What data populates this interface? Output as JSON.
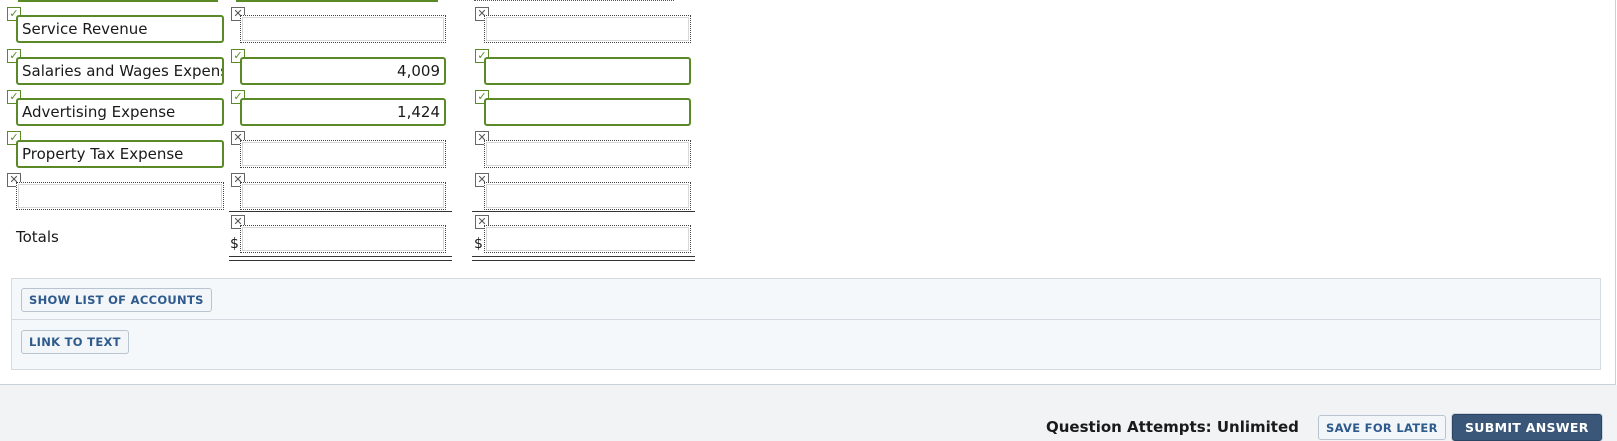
{
  "rows": [
    {
      "account": "Service Revenue",
      "debit": "",
      "credit": ""
    },
    {
      "account": "Salaries and Wages Expens",
      "debit": "4,009",
      "credit": ""
    },
    {
      "account": "Advertising Expense",
      "debit": "1,424",
      "credit": ""
    },
    {
      "account": "Property Tax Expense",
      "debit": "",
      "credit": ""
    },
    {
      "account": "",
      "debit": "",
      "credit": ""
    }
  ],
  "marks": {
    "check": "✓",
    "cross": "✕"
  },
  "totals": {
    "label": "Totals",
    "currency": "$",
    "debit": "",
    "credit": ""
  },
  "tools": {
    "show_accounts": "SHOW LIST OF ACCOUNTS",
    "link_text": "LINK TO TEXT"
  },
  "footer": {
    "attempts": "Question Attempts: Unlimited",
    "save": "SAVE FOR LATER",
    "submit": "SUBMIT ANSWER"
  },
  "colors": {
    "correct": "#5a8a28",
    "submit_bg": "#3a5779",
    "link": "#2e5a8c"
  }
}
